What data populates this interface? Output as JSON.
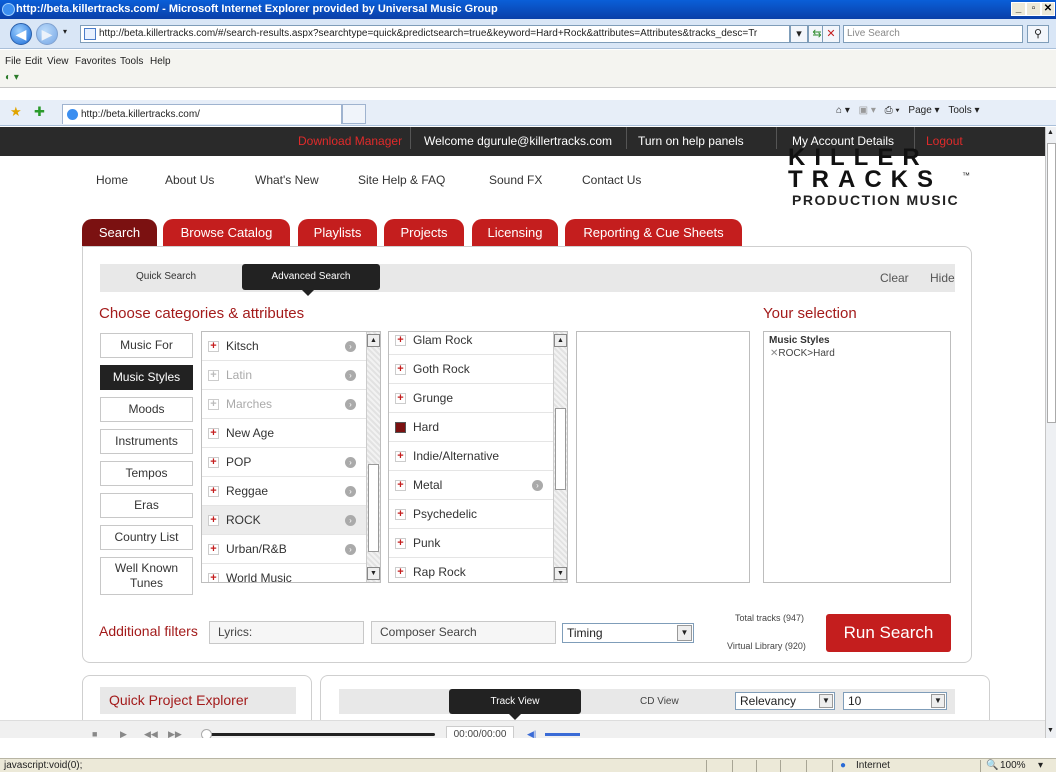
{
  "browser": {
    "title": "http://beta.killertracks.com/ - Microsoft Internet Explorer provided by Universal Music Group",
    "address": "http://beta.killertracks.com/#/search-results.aspx?searchtype=quick&predictsearch=true&keyword=Hard+Rock&attributes=Attributes&tracks_desc=Tr",
    "live_search_placeholder": "Live Search",
    "menu": [
      "File",
      "Edit",
      "View",
      "Favorites",
      "Tools",
      "Help"
    ],
    "tab_title": "http://beta.killertracks.com/",
    "tools_right": [
      "Page ▾",
      "Tools ▾"
    ],
    "status_text": "javascript:void(0);",
    "zone": "Internet",
    "zoom": "100%"
  },
  "topnav": {
    "download_manager": "Download Manager",
    "welcome": "Welcome dgurule@killertracks.com",
    "help_panels": "Turn on help panels",
    "account": "My Account Details",
    "logout": "Logout"
  },
  "site_links": [
    "Home",
    "About Us",
    "What's New",
    "Site Help & FAQ",
    "Sound FX",
    "Contact Us"
  ],
  "logo": {
    "line1": "KILLER",
    "line2": "TRACKS",
    "line3": "PRODUCTION MUSIC",
    "tm": "™"
  },
  "tabs": [
    "Search",
    "Browse Catalog",
    "Playlists",
    "Projects",
    "Licensing",
    "Reporting & Cue Sheets"
  ],
  "subnav": {
    "quick": "Quick Search",
    "advanced": "Advanced Search",
    "clear": "Clear",
    "hide": "Hide"
  },
  "choose_heading": "Choose categories & attributes",
  "your_selection_heading": "Your selection",
  "categories": [
    "Music For",
    "Music Styles",
    "Moods",
    "Instruments",
    "Tempos",
    "Eras",
    "Country List",
    "Well Known Tunes"
  ],
  "styles": [
    "Kitsch",
    "Latin",
    "Marches",
    "New Age",
    "POP",
    "Reggae",
    "ROCK",
    "Urban/R&B",
    "World Music"
  ],
  "rock_substyles": [
    "Glam Rock",
    "Goth Rock",
    "Grunge",
    "Hard",
    "Indie/Alternative",
    "Metal",
    "Psychedelic",
    "Punk",
    "Rap Rock"
  ],
  "selection": {
    "group": "Music Styles",
    "item": "ROCK>Hard"
  },
  "filters": {
    "label": "Additional filters",
    "lyrics_placeholder": "Lyrics:",
    "composer_placeholder": "Composer Search",
    "timing": "Timing",
    "total_tracks": "Total tracks (947)",
    "virtual_library": "Virtual Library (920)",
    "run": "Run Search"
  },
  "bottom": {
    "quick_project_explorer": "Quick Project Explorer",
    "track_view": "Track View",
    "cd_view": "CD View",
    "sort": "Relevancy",
    "per_page": "10"
  },
  "player": {
    "time": "00:00/00:00"
  }
}
